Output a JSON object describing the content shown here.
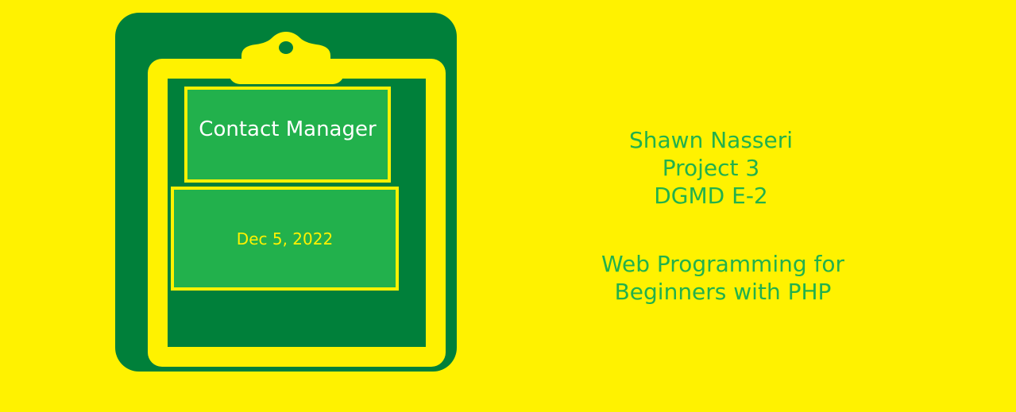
{
  "clipboard": {
    "title": "Contact Manager",
    "date": "Dec 5, 2022"
  },
  "info": {
    "author": "Shawn Nasseri",
    "project": "Project 3",
    "course_code": "DGMD E-2",
    "course_name_line1": "Web Programming for",
    "course_name_line2": "Beginners with PHP"
  },
  "colors": {
    "background": "#fff200",
    "dark_green": "#00803a",
    "green": "#22b14c",
    "text_white": "#ffffff"
  }
}
